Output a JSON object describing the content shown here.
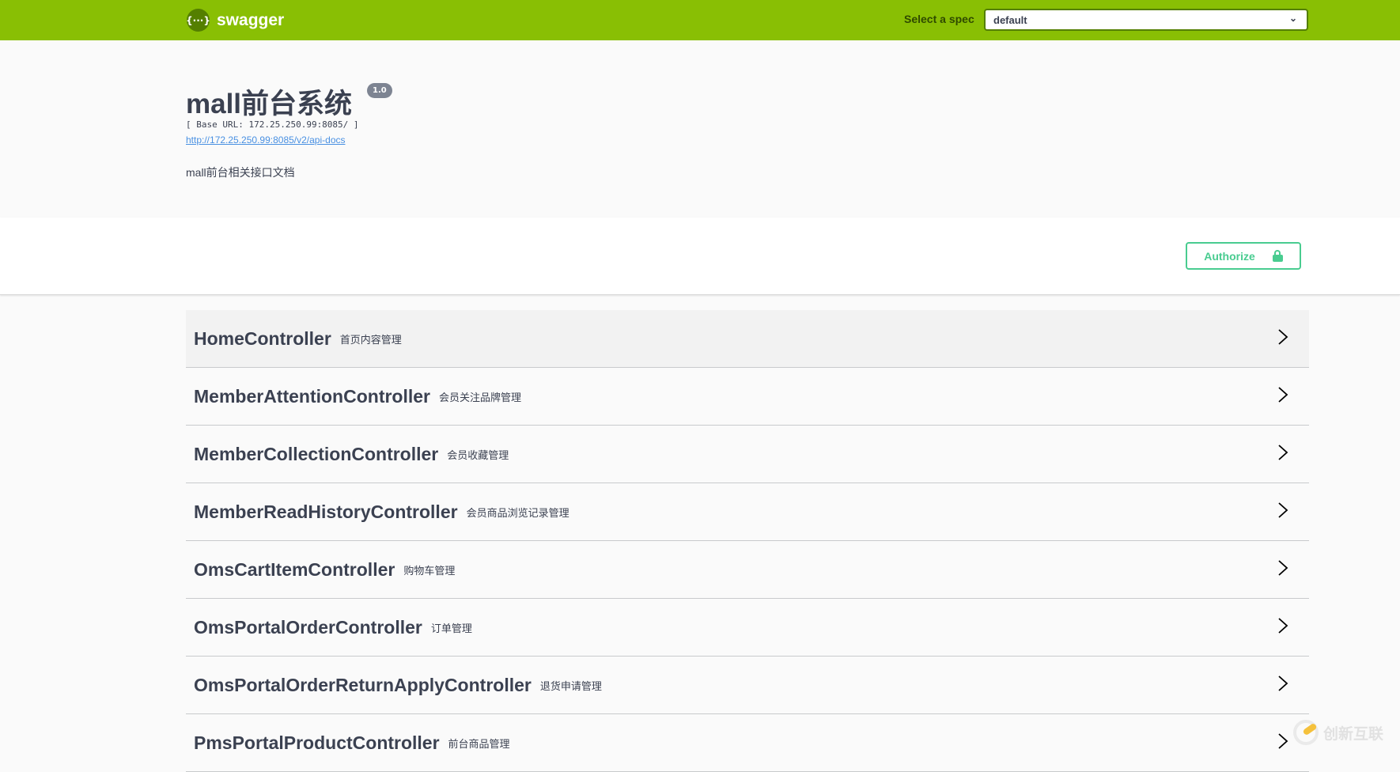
{
  "topbar": {
    "logo_text": "swagger",
    "logo_glyph": "{···}",
    "spec_label": "Select a spec",
    "spec_value": "default"
  },
  "info": {
    "title": "mall前台系统",
    "version": "1.0",
    "base_url": "[ Base URL: 172.25.250.99:8085/ ]",
    "api_docs_link": "http://172.25.250.99:8085/v2/api-docs",
    "description": "mall前台相关接口文档"
  },
  "auth": {
    "authorize_label": "Authorize"
  },
  "controllers": [
    {
      "name": "HomeController",
      "desc": "首页内容管理"
    },
    {
      "name": "MemberAttentionController",
      "desc": "会员关注品牌管理"
    },
    {
      "name": "MemberCollectionController",
      "desc": "会员收藏管理"
    },
    {
      "name": "MemberReadHistoryController",
      "desc": "会员商品浏览记录管理"
    },
    {
      "name": "OmsCartItemController",
      "desc": "购物车管理"
    },
    {
      "name": "OmsPortalOrderController",
      "desc": "订单管理"
    },
    {
      "name": "OmsPortalOrderReturnApplyController",
      "desc": "退货申请管理"
    },
    {
      "name": "PmsPortalProductController",
      "desc": "前台商品管理"
    }
  ],
  "watermark": {
    "text": "创新互联"
  },
  "colors": {
    "topbar": "#89bf04",
    "authorize": "#49cc90",
    "text": "#3b4151",
    "link": "#4990e2"
  }
}
